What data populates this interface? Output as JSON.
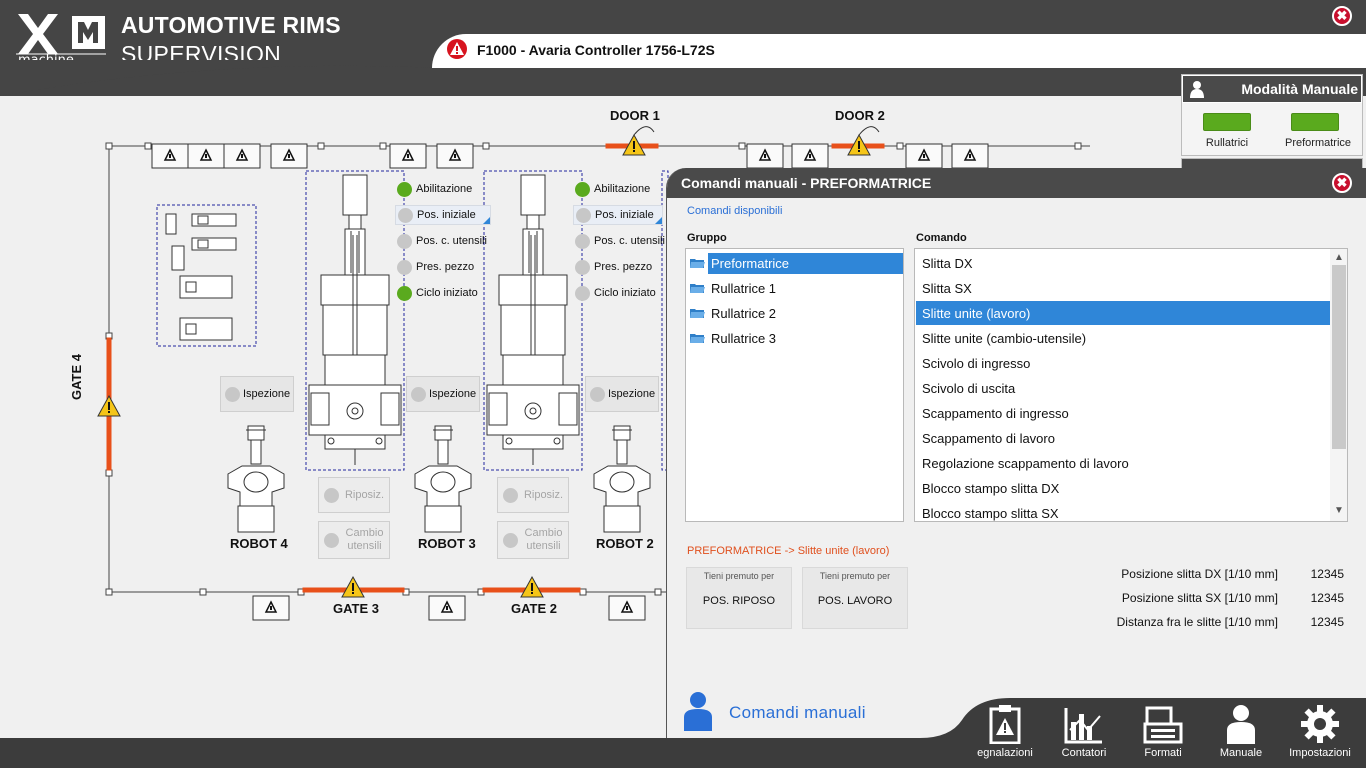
{
  "header": {
    "logo_text": "machine",
    "title": "AUTOMOTIVE RIMS",
    "subtitle": "SUPERVISION",
    "alarm": "F1000 - Avaria Controller 1756-L72S",
    "close_label": "✖"
  },
  "plant": {
    "doors": [
      "DOOR 1",
      "DOOR 2"
    ],
    "gates": {
      "gate4": "GATE 4",
      "gate3": "GATE 3",
      "gate2": "GATE 2"
    },
    "robots": [
      "ROBOT 4",
      "ROBOT 3",
      "ROBOT 2"
    ],
    "signals": [
      "Abilitazione",
      "Pos. iniziale",
      "Pos. c. utensili",
      "Pres. pezzo",
      "Ciclo iniziato"
    ],
    "signal_states_station1": [
      true,
      false,
      false,
      false,
      true
    ],
    "signal_states_station2": [
      true,
      false,
      false,
      false,
      false
    ],
    "inspection_label": "Ispezione",
    "reposition_label": "Riposiz.",
    "tool_change_label": "Cambio utensili",
    "colors": {
      "active": "#5aaa1e",
      "inactive": "#c7c7c7",
      "fence": "#e8501a",
      "warning": "#f5c518"
    }
  },
  "mode_panel": {
    "title": "Modalità Manuale",
    "items": [
      "Rullatrici",
      "Preformatrice"
    ]
  },
  "dialog": {
    "title": "Comandi manuali - PREFORMATRICE",
    "available_label": "Comandi disponibili",
    "group_header": "Gruppo",
    "command_header": "Comando",
    "groups": [
      "Preformatrice",
      "Rullatrice 1",
      "Rullatrice 2",
      "Rullatrice 3"
    ],
    "selected_group": 0,
    "commands": [
      "Slitta DX",
      "Slitta SX",
      "Slitte unite (lavoro)",
      "Slitte unite (cambio-utensile)",
      "Scivolo di ingresso",
      "Scivolo di uscita",
      "Scappamento di ingresso",
      "Scappamento di lavoro",
      "Regolazione scappamento di lavoro",
      "Blocco stampo slitta DX",
      "Blocco stampo slitta SX"
    ],
    "selected_command": 2,
    "selection_path": "PREFORMATRICE -> Slitte unite (lavoro)",
    "hold_hint": "Tieni premuto per",
    "hold_buttons": [
      "POS. RIPOSO",
      "POS. LAVORO"
    ],
    "measures": [
      {
        "label": "Posizione slitta DX [1/10 mm]",
        "value": "12345"
      },
      {
        "label": "Posizione slitta SX [1/10 mm]",
        "value": "12345"
      },
      {
        "label": "Distanza fra le slitte [1/10 mm]",
        "value": "12345"
      }
    ],
    "footer_label": "Comandi manuali"
  },
  "nav": [
    "egnalazioni",
    "Contatori",
    "Formati",
    "Manuale",
    "Impostazioni"
  ]
}
